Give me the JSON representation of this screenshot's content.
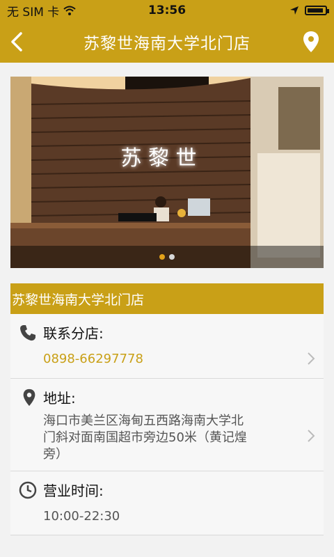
{
  "status_bar": {
    "carrier": "无 SIM 卡",
    "time": "13:56",
    "battery_level": 0.9
  },
  "nav": {
    "title": "苏黎世海南大学北门店",
    "back_icon": "chevron-left-icon",
    "location_icon": "map-pin-icon"
  },
  "hero": {
    "sign_text": "苏 黎 世",
    "slides": 2,
    "active_slide": 1
  },
  "store": {
    "name": "苏黎世海南大学北门店",
    "phone_label": "联系分店:",
    "phone": "0898-66297778",
    "address_label": "地址:",
    "address_lines": [
      "海口市美兰区海甸五西路海南大学北",
      "门斜对面南国超市旁边50米（黄记煌",
      "旁）"
    ],
    "hours_label": "营业时间:",
    "hours": "10:00-22:30"
  },
  "colors": {
    "brand": "#c9a017",
    "background": "#f2f2f2"
  }
}
